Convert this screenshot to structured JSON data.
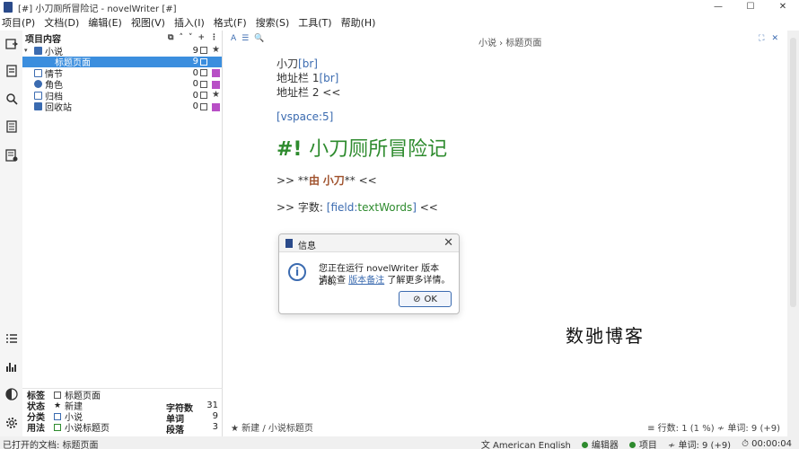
{
  "window": {
    "title": "[#] 小刀厕所冒险记 - novelWriter [#]",
    "min": "—",
    "max": "☐",
    "close": "✕"
  },
  "menu": [
    "项目(P)",
    "文档(D)",
    "编辑(E)",
    "视图(V)",
    "插入(I)",
    "格式(F)",
    "搜索(S)",
    "工具(T)",
    "帮助(H)"
  ],
  "tree": {
    "header": "项目内容",
    "header_icons": [
      "⧉",
      "˄",
      "˅",
      "+",
      "⋮"
    ],
    "rows": [
      {
        "label": "小说",
        "count": "9",
        "flag": "★",
        "arrow": "▾",
        "icon_color": "#3b6bb0"
      },
      {
        "label": "标题页面",
        "count": "9",
        "flag": "",
        "arrow": "",
        "icon_color": "#ffffff"
      },
      {
        "label": "情节",
        "count": "0",
        "flag": "■",
        "arrow": "",
        "icon_color": "#3b6bb0"
      },
      {
        "label": "角色",
        "count": "0",
        "flag": "■",
        "arrow": "",
        "icon_color": "#3b6bb0"
      },
      {
        "label": "归档",
        "count": "0",
        "flag": "★",
        "arrow": "",
        "icon_color": "#3b6bb0"
      },
      {
        "label": "回收站",
        "count": "0",
        "flag": "■",
        "arrow": "",
        "icon_color": "#3b6bb0"
      }
    ]
  },
  "details": {
    "rows": [
      {
        "key": "标签",
        "value": "标题页面"
      },
      {
        "key": "状态",
        "value": "新建"
      },
      {
        "key": "分类",
        "value": "小说"
      },
      {
        "key": "用法",
        "value": "小说标题页"
      }
    ],
    "stats": [
      {
        "key": "字符数",
        "value": "31"
      },
      {
        "key": "单词",
        "value": "9"
      },
      {
        "key": "段落",
        "value": "3"
      }
    ]
  },
  "editor": {
    "breadcrumb": "小说 › 标题页面",
    "tools_left": [
      "A",
      "☰",
      "🔍"
    ],
    "tools_right": [
      "⛶",
      "✕"
    ],
    "line1_text": "小刀",
    "line1_cmd": "[br]",
    "line2_text": "地址栏 1",
    "line2_cmd": "[br]",
    "line3": "地址栏 2 <<",
    "vspace": "[vspace:5]",
    "heading_mark": "#!",
    "heading_text": "小刀厕所冒险记",
    "by_prefix": ">> **",
    "by_word": "由",
    "by_name": "小刀",
    "by_suffix": "** <<",
    "words_prefix": ">> 字数: ",
    "words_cmd_open": "[field:",
    "words_cmd_val": "textWords",
    "words_cmd_close": "]",
    "words_suffix": " <<",
    "footer_left": "★ 新建 / 小说标题页",
    "footer_right": "≡ 行数: 1 (1 %)  ≁ 单词: 9 (+9)"
  },
  "dialog": {
    "title": "信息",
    "close": "✕",
    "msg1": "您正在运行 novelWriter 版本 2.8。",
    "msg2_prefix": "请检查 ",
    "msg2_link": "版本备注",
    "msg2_suffix": " 了解更多详情。",
    "ok_label": "OK",
    "ok_icon": "⊘"
  },
  "watermark": "数驰博客",
  "status": {
    "left": "已打开的文档: 标题页面",
    "lang": "American English",
    "editor": "编辑器",
    "project": "项目",
    "words": "单词: 9 (+9)",
    "time": "00:00:04"
  },
  "colors": {
    "accent": "#3b8ede",
    "link": "#3b6bb0",
    "heading": "#2e8b2e",
    "purple": "#b84fc6"
  }
}
